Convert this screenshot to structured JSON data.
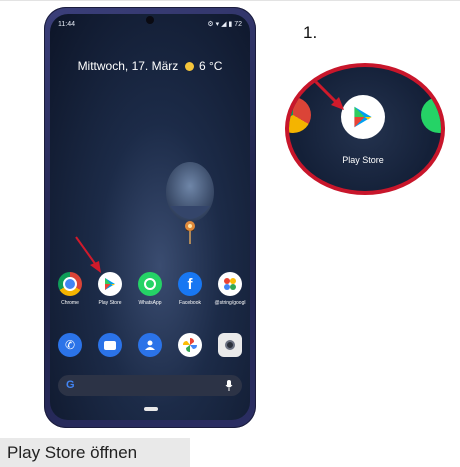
{
  "phone": {
    "status_time": "11:44",
    "status_icons": "⚙ ▾ ◢ ▮ 72",
    "date_text": "Mittwoch, 17. März",
    "temperature": "6 °C",
    "favorites": [
      {
        "label": "Chrome",
        "icon": "chrome-icon"
      },
      {
        "label": "Play Store",
        "icon": "play-store-icon"
      },
      {
        "label": "WhatsApp",
        "icon": "whatsapp-icon"
      },
      {
        "label": "Facebook",
        "icon": "facebook-icon"
      },
      {
        "label": "@string/googl",
        "icon": "google-photos-icon"
      }
    ],
    "dock": [
      {
        "icon": "phone-icon"
      },
      {
        "icon": "messages-icon"
      },
      {
        "icon": "contacts-icon"
      },
      {
        "icon": "photos-pinwheel-icon"
      },
      {
        "icon": "camera-icon"
      }
    ],
    "search_icon": "google-g-icon",
    "mic_icon": "mic-icon"
  },
  "zoom": {
    "step_label": "1.",
    "app_label": "Play Store"
  },
  "caption": "Play Store öffnen",
  "colors": {
    "highlight": "#c8162b",
    "phone_frame": "#2b2e63"
  }
}
